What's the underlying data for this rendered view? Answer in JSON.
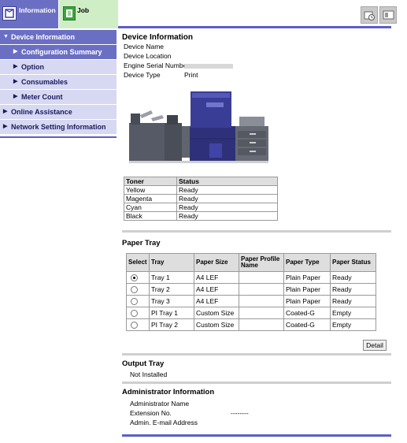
{
  "tabs": {
    "information": "Information",
    "job": "Job"
  },
  "sidebar": {
    "items": [
      {
        "label": "Device Information",
        "level": "top",
        "active": true,
        "caret": "▼"
      },
      {
        "label": "Configuration Summary",
        "level": "sub",
        "active": true,
        "caret": "▶"
      },
      {
        "label": "Option",
        "level": "sub",
        "active": false,
        "caret": "▶"
      },
      {
        "label": "Consumables",
        "level": "sub",
        "active": false,
        "caret": "▶"
      },
      {
        "label": "Meter Count",
        "level": "sub",
        "active": false,
        "caret": "▶"
      },
      {
        "label": "Online Assistance",
        "level": "top",
        "active": false,
        "caret": "▶"
      },
      {
        "label": "Network Setting Information",
        "level": "top",
        "active": false,
        "caret": "▶"
      }
    ]
  },
  "device_info": {
    "title": "Device Information",
    "fields": [
      {
        "key": "Device Name",
        "value": ""
      },
      {
        "key": "Device Location",
        "value": ""
      },
      {
        "key": "Engine Serial Number",
        "value": ""
      },
      {
        "key": "Device Type",
        "value": "Print"
      }
    ]
  },
  "toner": {
    "headers": [
      "Toner",
      "Status"
    ],
    "rows": [
      [
        "Yellow",
        "Ready"
      ],
      [
        "Magenta",
        "Ready"
      ],
      [
        "Cyan",
        "Ready"
      ],
      [
        "Black",
        "Ready"
      ]
    ]
  },
  "paper_tray": {
    "title": "Paper Tray",
    "headers": [
      "Select",
      "Tray",
      "Paper Size",
      "Paper Profile Name",
      "Paper Type",
      "Paper Status"
    ],
    "rows": [
      {
        "selected": true,
        "tray": "Tray 1",
        "size": "A4 LEF",
        "profile": "",
        "type": "Plain Paper",
        "status": "Ready"
      },
      {
        "selected": false,
        "tray": "Tray 2",
        "size": "A4 LEF",
        "profile": "",
        "type": "Plain Paper",
        "status": "Ready"
      },
      {
        "selected": false,
        "tray": "Tray 3",
        "size": "A4 LEF",
        "profile": "",
        "type": "Plain Paper",
        "status": "Ready"
      },
      {
        "selected": false,
        "tray": "PI Tray 1",
        "size": "Custom Size",
        "profile": "",
        "type": "Coated-G",
        "status": "Empty"
      },
      {
        "selected": false,
        "tray": "PI Tray 2",
        "size": "Custom Size",
        "profile": "",
        "type": "Coated-G",
        "status": "Empty"
      }
    ],
    "detail_label": "Detail"
  },
  "output_tray": {
    "title": "Output Tray",
    "value": "Not Installed"
  },
  "admin": {
    "title": "Administrator Information",
    "name_label": "Administrator Name",
    "ext_label": "Extension No.",
    "ext_value": "--------",
    "email_label": "Admin. E-mail Address"
  },
  "colors": {
    "accent": "#5b5fc7",
    "nav_active": "#6b6fc4",
    "nav_idle": "#d7d8f2",
    "job_tab": "#cfeec5"
  },
  "icons": [
    "info-tab-icon",
    "job-tab-icon",
    "device-refresh-icon",
    "display-icon",
    "printer-image"
  ]
}
